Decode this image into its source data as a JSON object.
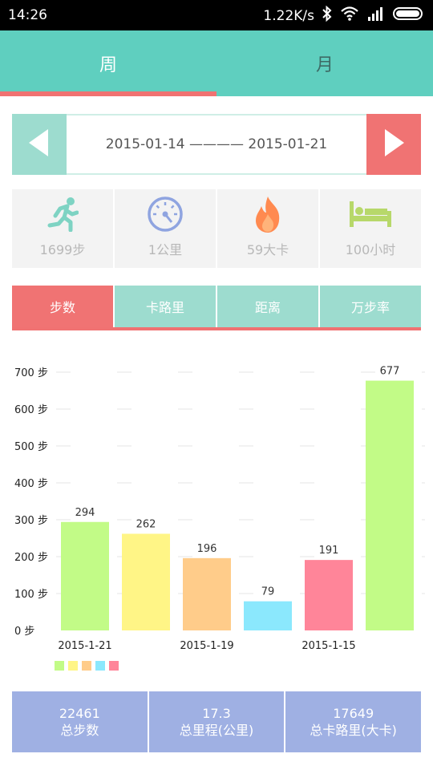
{
  "status_bar": {
    "time": "14:26",
    "speed": "1.22K/s"
  },
  "tabs": [
    {
      "label": "周"
    },
    {
      "label": "月"
    }
  ],
  "date_range": {
    "text": "2015-01-14 ———— 2015-01-21"
  },
  "stats": [
    {
      "icon": "running-icon",
      "value": "1699步"
    },
    {
      "icon": "speedometer-icon",
      "value": "1公里"
    },
    {
      "icon": "fire-icon",
      "value": "59大卡"
    },
    {
      "icon": "bed-icon",
      "value": "100小时"
    }
  ],
  "metric_tabs": [
    {
      "label": "步数"
    },
    {
      "label": "卡路里"
    },
    {
      "label": "距离"
    },
    {
      "label": "万步率"
    }
  ],
  "colors": {
    "teal": "#5fcfbf",
    "coral": "#f07373",
    "periwinkle": "#9fb0e3",
    "bar_colors": [
      "#c2fb87",
      "#fff586",
      "#ffcc8a",
      "#8be8fd",
      "#ff8599",
      "#c2fb87"
    ]
  },
  "chart_data": {
    "type": "bar",
    "y_ticks": [
      "0 步",
      "100 步",
      "200 步",
      "300 步",
      "400 步",
      "500 步",
      "600 步",
      "700 步"
    ],
    "ylim": [
      0,
      700
    ],
    "values": [
      294,
      262,
      196,
      79,
      191,
      677
    ],
    "x_labels": [
      "2015-1-21",
      "",
      "2015-1-19",
      "",
      "2015-1-15",
      ""
    ],
    "grid": true,
    "legend_swatches": 5
  },
  "totals": [
    {
      "value": "22461",
      "label": "总步数"
    },
    {
      "value": "17.3",
      "label": "总里程(公里)"
    },
    {
      "value": "17649",
      "label": "总卡路里(大卡)"
    }
  ]
}
